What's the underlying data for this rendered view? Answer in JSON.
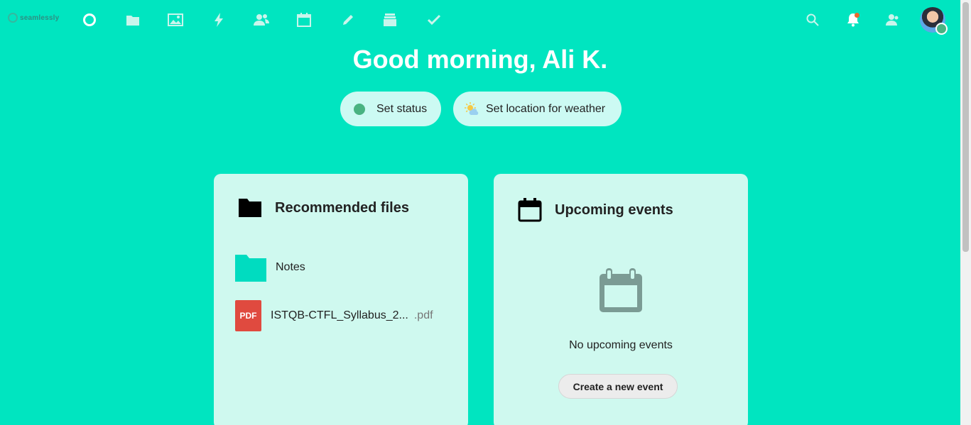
{
  "brand": {
    "logo_text": "seamlessly"
  },
  "nav": {
    "apps": [
      {
        "name": "dashboard",
        "icon": "circle-icon"
      },
      {
        "name": "files",
        "icon": "folder-icon"
      },
      {
        "name": "photos",
        "icon": "image-icon"
      },
      {
        "name": "activity",
        "icon": "lightning-icon"
      },
      {
        "name": "contacts",
        "icon": "users-icon"
      },
      {
        "name": "calendar",
        "icon": "calendar-icon"
      },
      {
        "name": "notes",
        "icon": "pencil-icon"
      },
      {
        "name": "deck",
        "icon": "stack-icon"
      },
      {
        "name": "tasks",
        "icon": "checkmark-icon"
      }
    ],
    "right": [
      {
        "name": "search",
        "icon": "search-icon"
      },
      {
        "name": "notifications",
        "icon": "bell-icon"
      },
      {
        "name": "contacts-menu",
        "icon": "user-icon"
      }
    ]
  },
  "greeting": "Good morning, Ali K.",
  "status_buttons": {
    "set_status": "Set status",
    "set_weather": "Set location for weather"
  },
  "recommended": {
    "title": "Recommended files",
    "files": [
      {
        "name": "Notes",
        "ext": "",
        "type": "folder"
      },
      {
        "name": "ISTQB-CTFL_Syllabus_2...",
        "ext": ".pdf",
        "type": "pdf"
      }
    ],
    "pdf_badge": "PDF"
  },
  "events": {
    "title": "Upcoming events",
    "empty_text": "No upcoming events",
    "create_button": "Create a new event"
  },
  "colors": {
    "background": "#00e5c0",
    "panel": "#cff9ef",
    "status_online": "#49b382",
    "notification_dot": "#e9692c",
    "pdf": "#e04a3f"
  }
}
